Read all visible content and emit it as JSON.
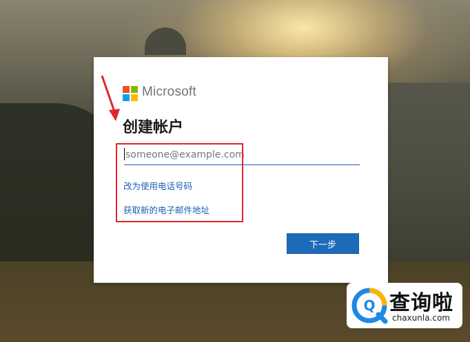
{
  "brand": {
    "name": "Microsoft",
    "colors": [
      "#f25022",
      "#7fba00",
      "#00a4ef",
      "#ffb900"
    ]
  },
  "dialog": {
    "title": "创建帐户",
    "email": {
      "value": "",
      "placeholder": "someone@example.com"
    },
    "links": {
      "use_phone": "改为使用电话号码",
      "get_new_email": "获取新的电子邮件地址"
    },
    "next_button": "下一步"
  },
  "annotation": {
    "color": "#e0262b"
  },
  "watermark": {
    "title": "查询啦",
    "url": "chaxunla.com"
  }
}
